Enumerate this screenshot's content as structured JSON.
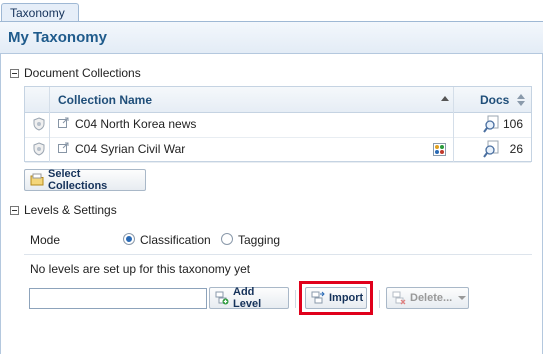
{
  "tab": {
    "label": "Taxonomy"
  },
  "header": {
    "title": "My Taxonomy"
  },
  "collections": {
    "section_label": "Document Collections",
    "columns": {
      "name": "Collection Name",
      "docs": "Docs"
    },
    "rows": [
      {
        "name": "C04 North Korea news",
        "docs": "106"
      },
      {
        "name": "C04 Syrian Civil War",
        "docs": "26"
      }
    ],
    "select_button": "Select Collections"
  },
  "levels": {
    "section_label": "Levels & Settings",
    "mode_label": "Mode",
    "mode_options": [
      {
        "label": "Classification",
        "selected": true
      },
      {
        "label": "Tagging",
        "selected": false
      }
    ],
    "empty_message": "No levels are set up for this taxonomy yet",
    "level_input_value": "",
    "add_level_button": "Add Level",
    "import_button": "Import",
    "delete_button": "Delete..."
  },
  "colors": {
    "accent": "#1f5b8c",
    "highlight": "#e0001b"
  }
}
